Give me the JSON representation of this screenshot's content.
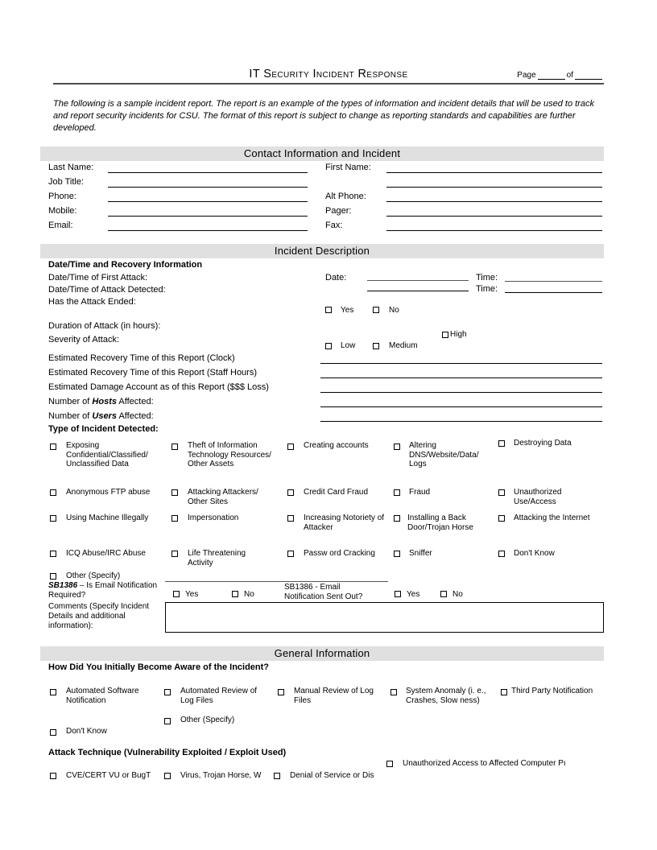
{
  "header": {
    "title": "IT Security Incident Response",
    "page_label": "Page",
    "of_label": "of"
  },
  "intro": {
    "text": "The following is a sample incident report.  The report is an example of the types of information and incident details that will be used to track and report security incidents for CSU.  The format of this report is subject to change as reporting standards and capabilities are further developed."
  },
  "sections": {
    "contact": "Contact Information and Incident",
    "incident": "Incident Description",
    "general": "General Information"
  },
  "contact": {
    "left_labels": [
      "Last Name:",
      "Job Title:",
      "Phone:",
      "Mobile:",
      "Email:"
    ],
    "right_labels": [
      "First Name:",
      "Alt Phone:",
      "Pager:",
      "Fax:"
    ]
  },
  "incident": {
    "datetime_heading": "Date/Time and Recovery Information",
    "rows": [
      "Date/Time of First Attack:",
      "Date/Time of Attack Detected:",
      "Has the Attack Ended:",
      "Duration of Attack (in hours):",
      "Severity of Attack:"
    ],
    "date_label": "Date:",
    "time_label_1": "Time:",
    "time_label_2": "Time:",
    "ended_options": [
      "Yes",
      "No"
    ],
    "severity_high": "High",
    "severity_options": [
      "Low",
      "Medium"
    ],
    "estimate_rows": [
      "Estimated Recovery Time of this Report (Clock)",
      "Estimated Recovery Time of this Report (Staff Hours)",
      "Estimated Damage Account as of this Report ($$$ Loss)",
      "Number of Hosts Affected:",
      "Number of Users Affected:"
    ],
    "hosts_prefix": "Number of ",
    "hosts_em": "Hosts",
    "hosts_suffix": " Affected:",
    "users_prefix": "Number of ",
    "users_em": "Users",
    "users_suffix": " Affected:",
    "type_heading": "Type of Incident Detected:",
    "type_options": [
      "Exposing Confidential/Classified/ Unclassified Data",
      "Theft of Information Technology Resources/ Other Assets",
      "Creating accounts",
      "Altering DNS/Website/Data/ Logs",
      "Destroying Data",
      "Anonymous FTP abuse",
      "Attacking Attackers/ Other Sites",
      "Credit Card Fraud",
      "Fraud",
      "Unauthorized Use/Access",
      "Using Machine Illegally",
      "Impersonation",
      "Increasing Notoriety of Attacker",
      " Installing a Back Door/Trojan Horse",
      "Attacking the Internet",
      "ICQ Abuse/IRC Abuse",
      "Life Threatening Activity",
      "Passw ord Cracking",
      "Sniffer",
      "Don't Know",
      "Other (Specify)"
    ],
    "sb1386_required_em": "SB1386",
    "sb1386_required_rest": " – Is Email Notification Required?",
    "sb1386_required_options": [
      "Yes",
      "No"
    ],
    "sb1386_sent_label": "SB1386 - Email Notification Sent Out?",
    "sb1386_sent_options": [
      "Yes",
      "No"
    ],
    "comments_label": "Comments (Specify Incident Details and additional information):",
    "comments_value": ""
  },
  "general": {
    "aware_heading": "How Did You Initially Become Aware of the Incident?",
    "aware_options": [
      "Automated Software Notification",
      "Automated Review of Log Files",
      "Manual Review of Log Files",
      "System Anomaly (i. e., Crashes, Slow ness)",
      "Third Party Notification",
      "Other (Specify)",
      "Don't Know"
    ],
    "attack_heading": "Attack Technique (Vulnerability Exploited / Exploit Used)",
    "attack_options": [
      "Unauthorized Access to Affected Computer Pı",
      "CVE/CERT VU or BugT",
      "Virus, Trojan Horse, W",
      "Denial of Service or Dis"
    ]
  },
  "colors": {
    "section_bar_bg": "#e0e0e0",
    "rule": "#000000",
    "header_rule": "#4d4d4d"
  }
}
